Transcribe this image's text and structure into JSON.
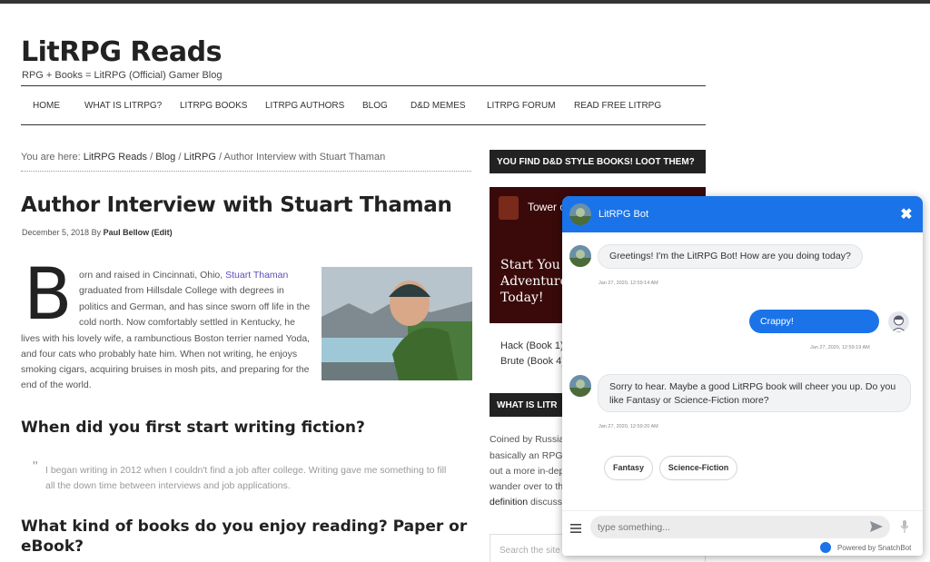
{
  "site": {
    "title": "LitRPG Reads",
    "description": "RPG + Books = LitRPG (Official) Gamer Blog"
  },
  "nav": {
    "items": [
      "HOME",
      "WHAT IS LITRPG?",
      "LITRPG BOOKS",
      "LITRPG AUTHORS",
      "BLOG",
      "D&D MEMES",
      "LITRPG FORUM",
      "READ FREE LITRPG"
    ]
  },
  "breadcrumb": {
    "prefix": "You are here:",
    "crumbs": [
      "LitRPG Reads",
      "Blog",
      "LitRPG"
    ],
    "separator": "/",
    "current": "Author Interview with Stuart Thaman"
  },
  "post": {
    "title": "Author Interview with Stuart Thaman",
    "date": "December 5, 2018",
    "by": "By",
    "author": "Paul Bellow",
    "edit": "(Edit)",
    "dropcap": "B",
    "intro_lines": [
      "orn and raised in Cincinnati, Ohio,",
      "graduated from Hillsdale College with degrees in",
      "politics and German, and has since sworn off life in the",
      "cold north. Now comfortably settled in Kentucky, he",
      "lives with his lovely wife, a rambunctious Boston terrier named Yoda,",
      "and four cats who probably hate him. When not writing, he enjoys",
      "smoking cigars, acquiring bruises in mosh pits, and preparing for the",
      "end of the world."
    ],
    "intro_link": "Stuart Thaman",
    "q1": "When did you first start writing fiction?",
    "a1_lines": [
      "I began writing in 2012 when I couldn't find a job after college. Writing gave me something to fill",
      "all the down time between interviews and job applications."
    ],
    "q2_lines": [
      "What kind of books do you enjoy reading? Paper or",
      "eBook?"
    ]
  },
  "sidebar": {
    "widget1_title": "YOU FIND D&D STYLE BOOKS! LOOT THEM?",
    "banner_title": "Tower o",
    "banner_lines": [
      "Start You",
      "Adventure",
      "Today!"
    ],
    "books": [
      "Hack (Book 1)",
      "Brute (Book 4)"
    ],
    "widget2_title": "WHAT IS LITR",
    "text_lines": [
      "Coined by Russia",
      "basically an RPG",
      "out a more in-dep",
      "wander over to th"
    ],
    "definition_link": "definition",
    "definition_tail": " discuss",
    "search_placeholder": "Search the site"
  },
  "chat": {
    "bot_name": "LitRPG Bot",
    "close_glyph": "✖",
    "messages": [
      {
        "from": "bot",
        "text_lines": [
          "Greetings! I'm the LitRPG Bot! How are you doing today?"
        ],
        "time": "Jan 27, 2020, 12:59:14 AM"
      },
      {
        "from": "user",
        "text_lines": [
          "Crappy!"
        ],
        "time": "Jan 27, 2020, 12:59:19 AM"
      },
      {
        "from": "bot",
        "text_lines": [
          "Sorry to hear. Maybe a good LitRPG book will cheer you up. Do you",
          "like Fantasy or Science-Fiction more?"
        ],
        "time": "Jan 27, 2020, 12:59:20 AM"
      }
    ],
    "quick_replies": [
      "Fantasy",
      "Science-Fiction"
    ],
    "input_placeholder": "type something...",
    "powered_by": "Powered by SnatchBot"
  },
  "colors": {
    "chat_accent": "#1a73e8",
    "widget_header": "#222222",
    "link_purple": "#5b4fb8"
  },
  "icons": [
    "menu-icon",
    "send-icon",
    "mic-icon",
    "close-icon",
    "bot-avatar",
    "user-avatar"
  ]
}
